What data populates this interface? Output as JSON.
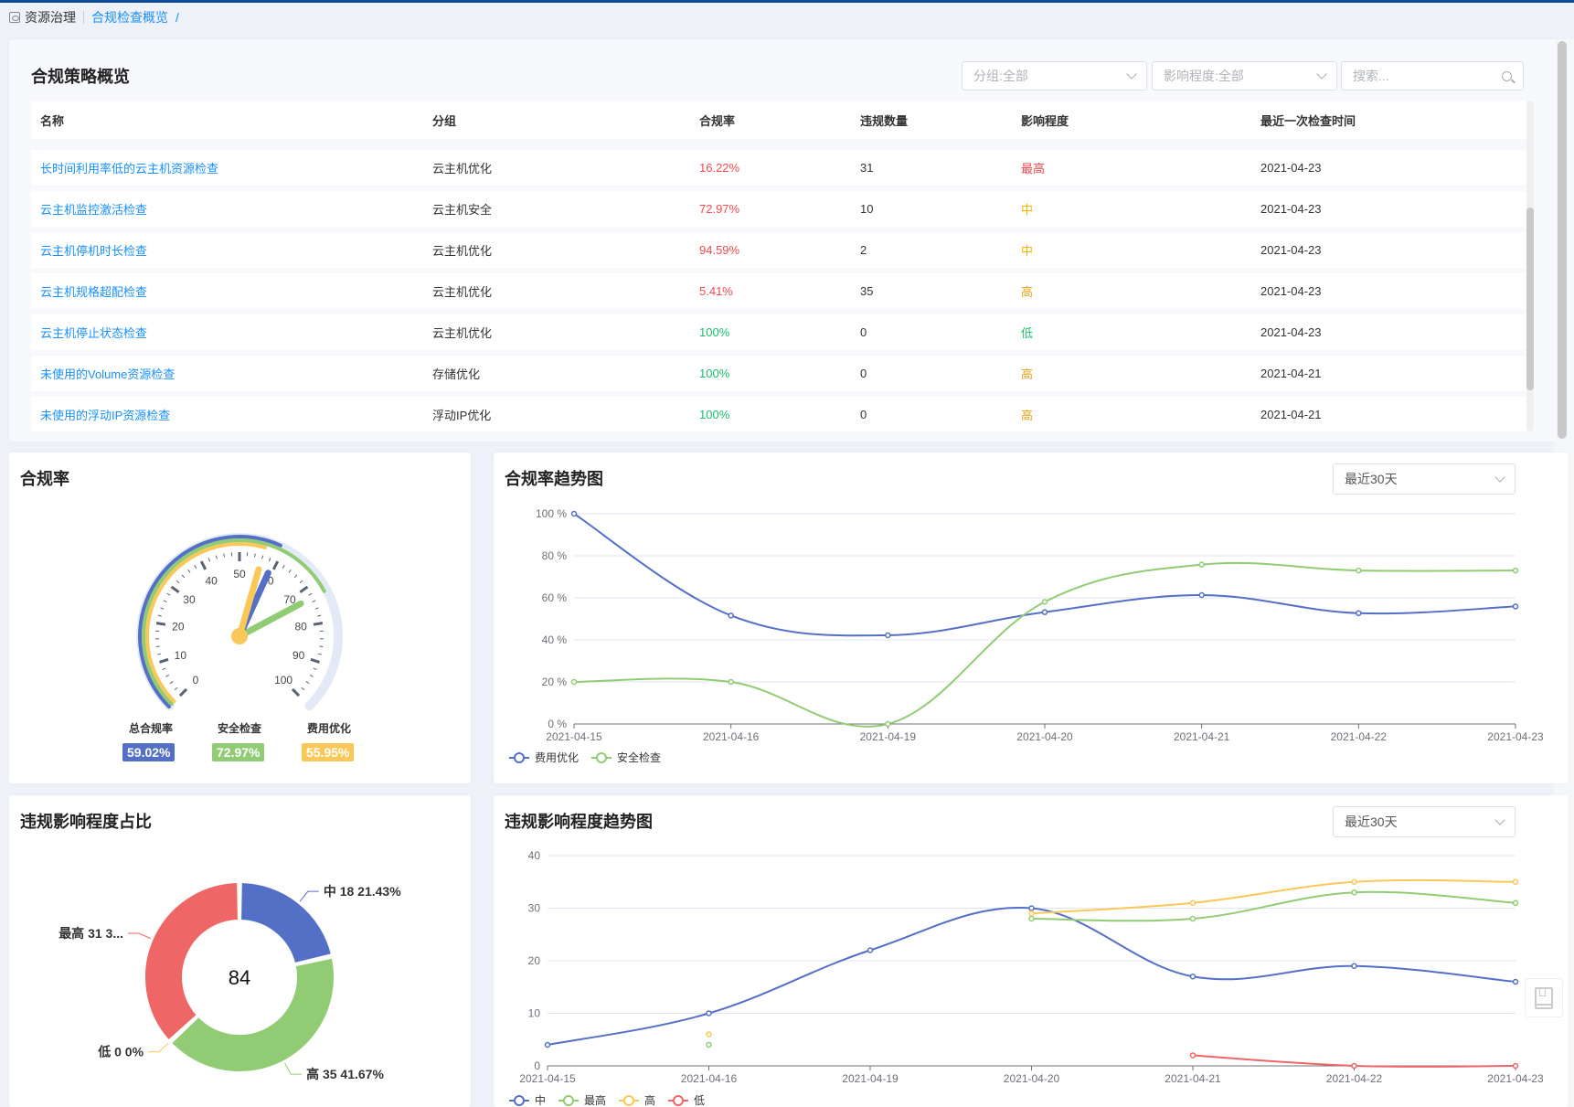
{
  "breadcrumb": {
    "root": "资源治理",
    "current": "合规检查概览",
    "separator": "/"
  },
  "policy": {
    "title": "合规策略概览",
    "filters": {
      "group": "分组:全部",
      "impact": "影响程度:全部",
      "search_placeholder": "搜索..."
    },
    "columns": [
      "名称",
      "分组",
      "合规率",
      "违规数量",
      "影响程度",
      "最近一次检查时间"
    ],
    "rows": [
      {
        "name": "长时间利用率低的云主机资源检查",
        "group": "云主机优化",
        "rate": "16.22%",
        "rate_status": "bad",
        "count": "31",
        "impact": "最高",
        "impact_level": "highest",
        "time": "2021-04-23"
      },
      {
        "name": "云主机监控激活检查",
        "group": "云主机安全",
        "rate": "72.97%",
        "rate_status": "bad",
        "count": "10",
        "impact": "中",
        "impact_level": "medium",
        "time": "2021-04-23"
      },
      {
        "name": "云主机停机时长检查",
        "group": "云主机优化",
        "rate": "94.59%",
        "rate_status": "bad",
        "count": "2",
        "impact": "中",
        "impact_level": "medium",
        "time": "2021-04-23"
      },
      {
        "name": "云主机规格超配检查",
        "group": "云主机优化",
        "rate": "5.41%",
        "rate_status": "bad",
        "count": "35",
        "impact": "高",
        "impact_level": "high",
        "time": "2021-04-23"
      },
      {
        "name": "云主机停止状态检查",
        "group": "云主机优化",
        "rate": "100%",
        "rate_status": "good",
        "count": "0",
        "impact": "低",
        "impact_level": "low",
        "time": "2021-04-23"
      },
      {
        "name": "未使用的Volume资源检查",
        "group": "存储优化",
        "rate": "100%",
        "rate_status": "good",
        "count": "0",
        "impact": "高",
        "impact_level": "high",
        "time": "2021-04-21"
      },
      {
        "name": "未使用的浮动IP资源检查",
        "group": "浮动IP优化",
        "rate": "100%",
        "rate_status": "good",
        "count": "0",
        "impact": "高",
        "impact_level": "high",
        "time": "2021-04-21"
      }
    ]
  },
  "colors": {
    "link": "#1890ff",
    "bad": "#f5484f",
    "good": "#19be6b",
    "highest": "#e5484d",
    "medium": "#f7b500",
    "high": "#e6a118",
    "low": "#19be6b",
    "blue": "#5470c6",
    "green": "#91cc75",
    "yellow": "#fac858",
    "red": "#ee6666",
    "gauge_track": "#e3e9f5"
  },
  "compliance": {
    "title": "合规率",
    "gauges": [
      {
        "label": "总合规率",
        "value": 59.02,
        "text": "59.02%",
        "color": "#5470c6"
      },
      {
        "label": "安全检查",
        "value": 72.97,
        "text": "72.97%",
        "color": "#91cc75"
      },
      {
        "label": "费用优化",
        "value": 55.95,
        "text": "55.95%",
        "color": "#fac858"
      }
    ],
    "ticks": [
      "0",
      "10",
      "20",
      "30",
      "40",
      "50",
      "60",
      "70",
      "80",
      "90",
      "100"
    ]
  },
  "trend": {
    "title": "合规率趋势图",
    "range": "最近30天"
  },
  "impact_ratio": {
    "title": "违规影响程度占比",
    "total": "84"
  },
  "impact_trend": {
    "title": "违规影响程度趋势图",
    "range": "最近30天"
  },
  "chart_data": [
    {
      "type": "gauge",
      "title": "合规率",
      "min": 0,
      "max": 100,
      "series": [
        {
          "name": "总合规率",
          "value": 59.02
        },
        {
          "name": "安全检查",
          "value": 72.97
        },
        {
          "name": "费用优化",
          "value": 55.95
        }
      ]
    },
    {
      "type": "line",
      "title": "合规率趋势图",
      "x": [
        "2021-04-15",
        "2021-04-16",
        "2021-04-19",
        "2021-04-20",
        "2021-04-21",
        "2021-04-22",
        "2021-04-23"
      ],
      "yticks": [
        "0 %",
        "20 %",
        "40 %",
        "60 %",
        "80 %",
        "100 %"
      ],
      "ylim": [
        0,
        100
      ],
      "grid": true,
      "legend": "bottom-left",
      "series": [
        {
          "name": "费用优化",
          "color": "#5470c6",
          "values": [
            100,
            51.6,
            42.2,
            53.2,
            61.3,
            52.7,
            55.9
          ]
        },
        {
          "name": "安全检查",
          "color": "#91cc75",
          "values": [
            20,
            20,
            0,
            58.1,
            75.8,
            73,
            73
          ]
        }
      ]
    },
    {
      "type": "pie",
      "title": "违规影响程度占比",
      "center_label": "84",
      "slices": [
        {
          "name": "中",
          "value": 18,
          "percent": "21.43%",
          "label": "中  18  21.43%",
          "color": "#5470c6"
        },
        {
          "name": "高",
          "value": 35,
          "percent": "41.67%",
          "label": "高  35  41.67%",
          "color": "#91cc75"
        },
        {
          "name": "低",
          "value": 0,
          "percent": "0%",
          "label": "低  0  0%",
          "color": "#fac858"
        },
        {
          "name": "最高",
          "value": 31,
          "percent": "36.90%",
          "label": "最高  31  3...",
          "color": "#ee6666"
        }
      ]
    },
    {
      "type": "line",
      "title": "违规影响程度趋势图",
      "x": [
        "2021-04-15",
        "2021-04-16",
        "2021-04-19",
        "2021-04-20",
        "2021-04-21",
        "2021-04-22",
        "2021-04-23"
      ],
      "yticks": [
        "0",
        "10",
        "20",
        "30",
        "40"
      ],
      "ylim": [
        0,
        40
      ],
      "grid": true,
      "legend": "bottom-left",
      "series": [
        {
          "name": "中",
          "color": "#5470c6",
          "values": [
            4,
            10,
            22,
            30,
            17,
            19,
            16
          ]
        },
        {
          "name": "最高",
          "color": "#91cc75",
          "values": [
            null,
            4,
            null,
            28,
            28,
            33,
            31
          ]
        },
        {
          "name": "高",
          "color": "#fac858",
          "values": [
            null,
            6,
            null,
            29,
            31,
            35,
            35
          ]
        },
        {
          "name": "低",
          "color": "#ee6666",
          "values": [
            null,
            null,
            null,
            null,
            2,
            0,
            0
          ]
        }
      ]
    }
  ]
}
